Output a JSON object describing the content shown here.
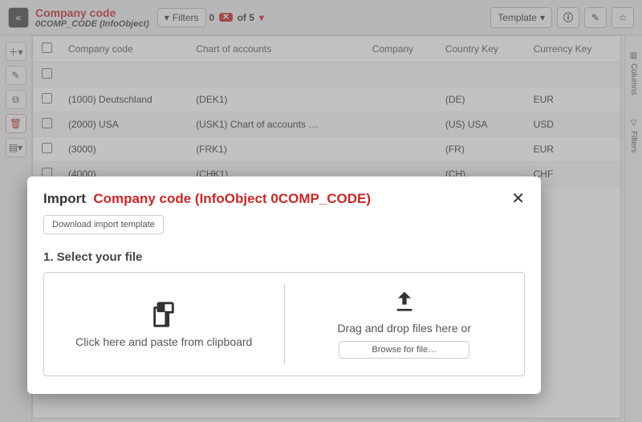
{
  "header": {
    "title": "Company code",
    "subtitle": "0COMP_CODE (InfoObject)",
    "filters_label": "Filters",
    "count_a": "0",
    "count_b": "of 5",
    "template_label": "Template"
  },
  "rail": {
    "add": "+",
    "edit": "✎",
    "copy": "⧉",
    "del": "🗑",
    "more": "▾"
  },
  "side_tabs": {
    "columns": "Columns",
    "filters": "Filters"
  },
  "table": {
    "headers": [
      "Company code",
      "Chart of accounts",
      "Company",
      "Country Key",
      "Currency Key"
    ],
    "rows": [
      [
        "(1000) Deutschland",
        "(DEK1)",
        "",
        "(DE)",
        "EUR"
      ],
      [
        "(2000) USA",
        "(USK1) Chart of accounts …",
        "",
        "(US) USA",
        "USD"
      ],
      [
        "(3000)",
        "(FRK1)",
        "",
        "(FR)",
        "EUR"
      ],
      [
        "(4000)",
        "(CHK1)",
        "",
        "(CH)",
        "CHF"
      ]
    ]
  },
  "modal": {
    "prefix": "Import",
    "title_red": "Company code (InfoObject 0COMP_CODE)",
    "download": "Download import template",
    "step": "1. Select your file",
    "paste": "Click here and paste from clipboard",
    "drop": "Drag and drop files here or",
    "browse": "Browse for file…"
  }
}
